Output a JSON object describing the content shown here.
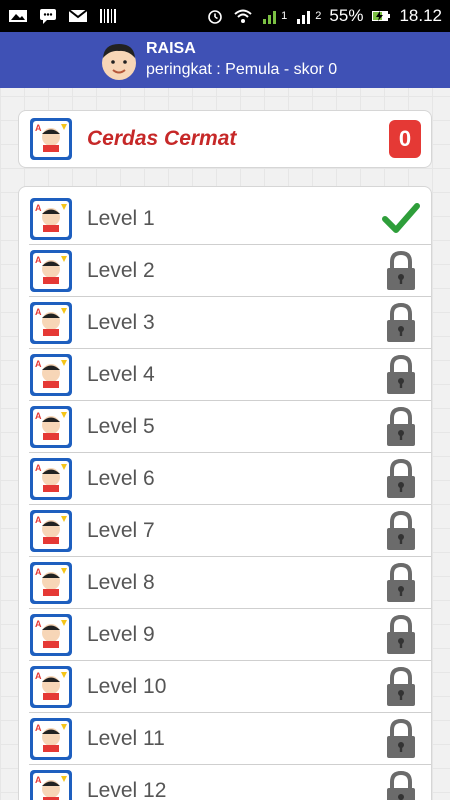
{
  "status_bar": {
    "battery": "55%",
    "time": "18.12",
    "sim1": "1",
    "sim2": "2"
  },
  "header": {
    "user_name": "RAISA",
    "rank_text": "peringkat : Pemula - skor 0"
  },
  "title_card": {
    "title": "Cerdas Cermat",
    "score": "0"
  },
  "levels": [
    {
      "label": "Level 1",
      "state": "check-icon"
    },
    {
      "label": "Level 2",
      "state": "lock-icon"
    },
    {
      "label": "Level 3",
      "state": "lock-icon"
    },
    {
      "label": "Level 4",
      "state": "lock-icon"
    },
    {
      "label": "Level 5",
      "state": "lock-icon"
    },
    {
      "label": "Level 6",
      "state": "lock-icon"
    },
    {
      "label": "Level 7",
      "state": "lock-icon"
    },
    {
      "label": "Level 8",
      "state": "lock-icon"
    },
    {
      "label": "Level 9",
      "state": "lock-icon"
    },
    {
      "label": "Level 10",
      "state": "lock-icon"
    },
    {
      "label": "Level 11",
      "state": "lock-icon"
    },
    {
      "label": "Level 12",
      "state": "lock-icon"
    }
  ],
  "colors": {
    "header": "#3f51b5",
    "title": "#c62828",
    "badge": "#e53935",
    "check": "#2e9e3a",
    "lock": "#6b6b6b"
  }
}
